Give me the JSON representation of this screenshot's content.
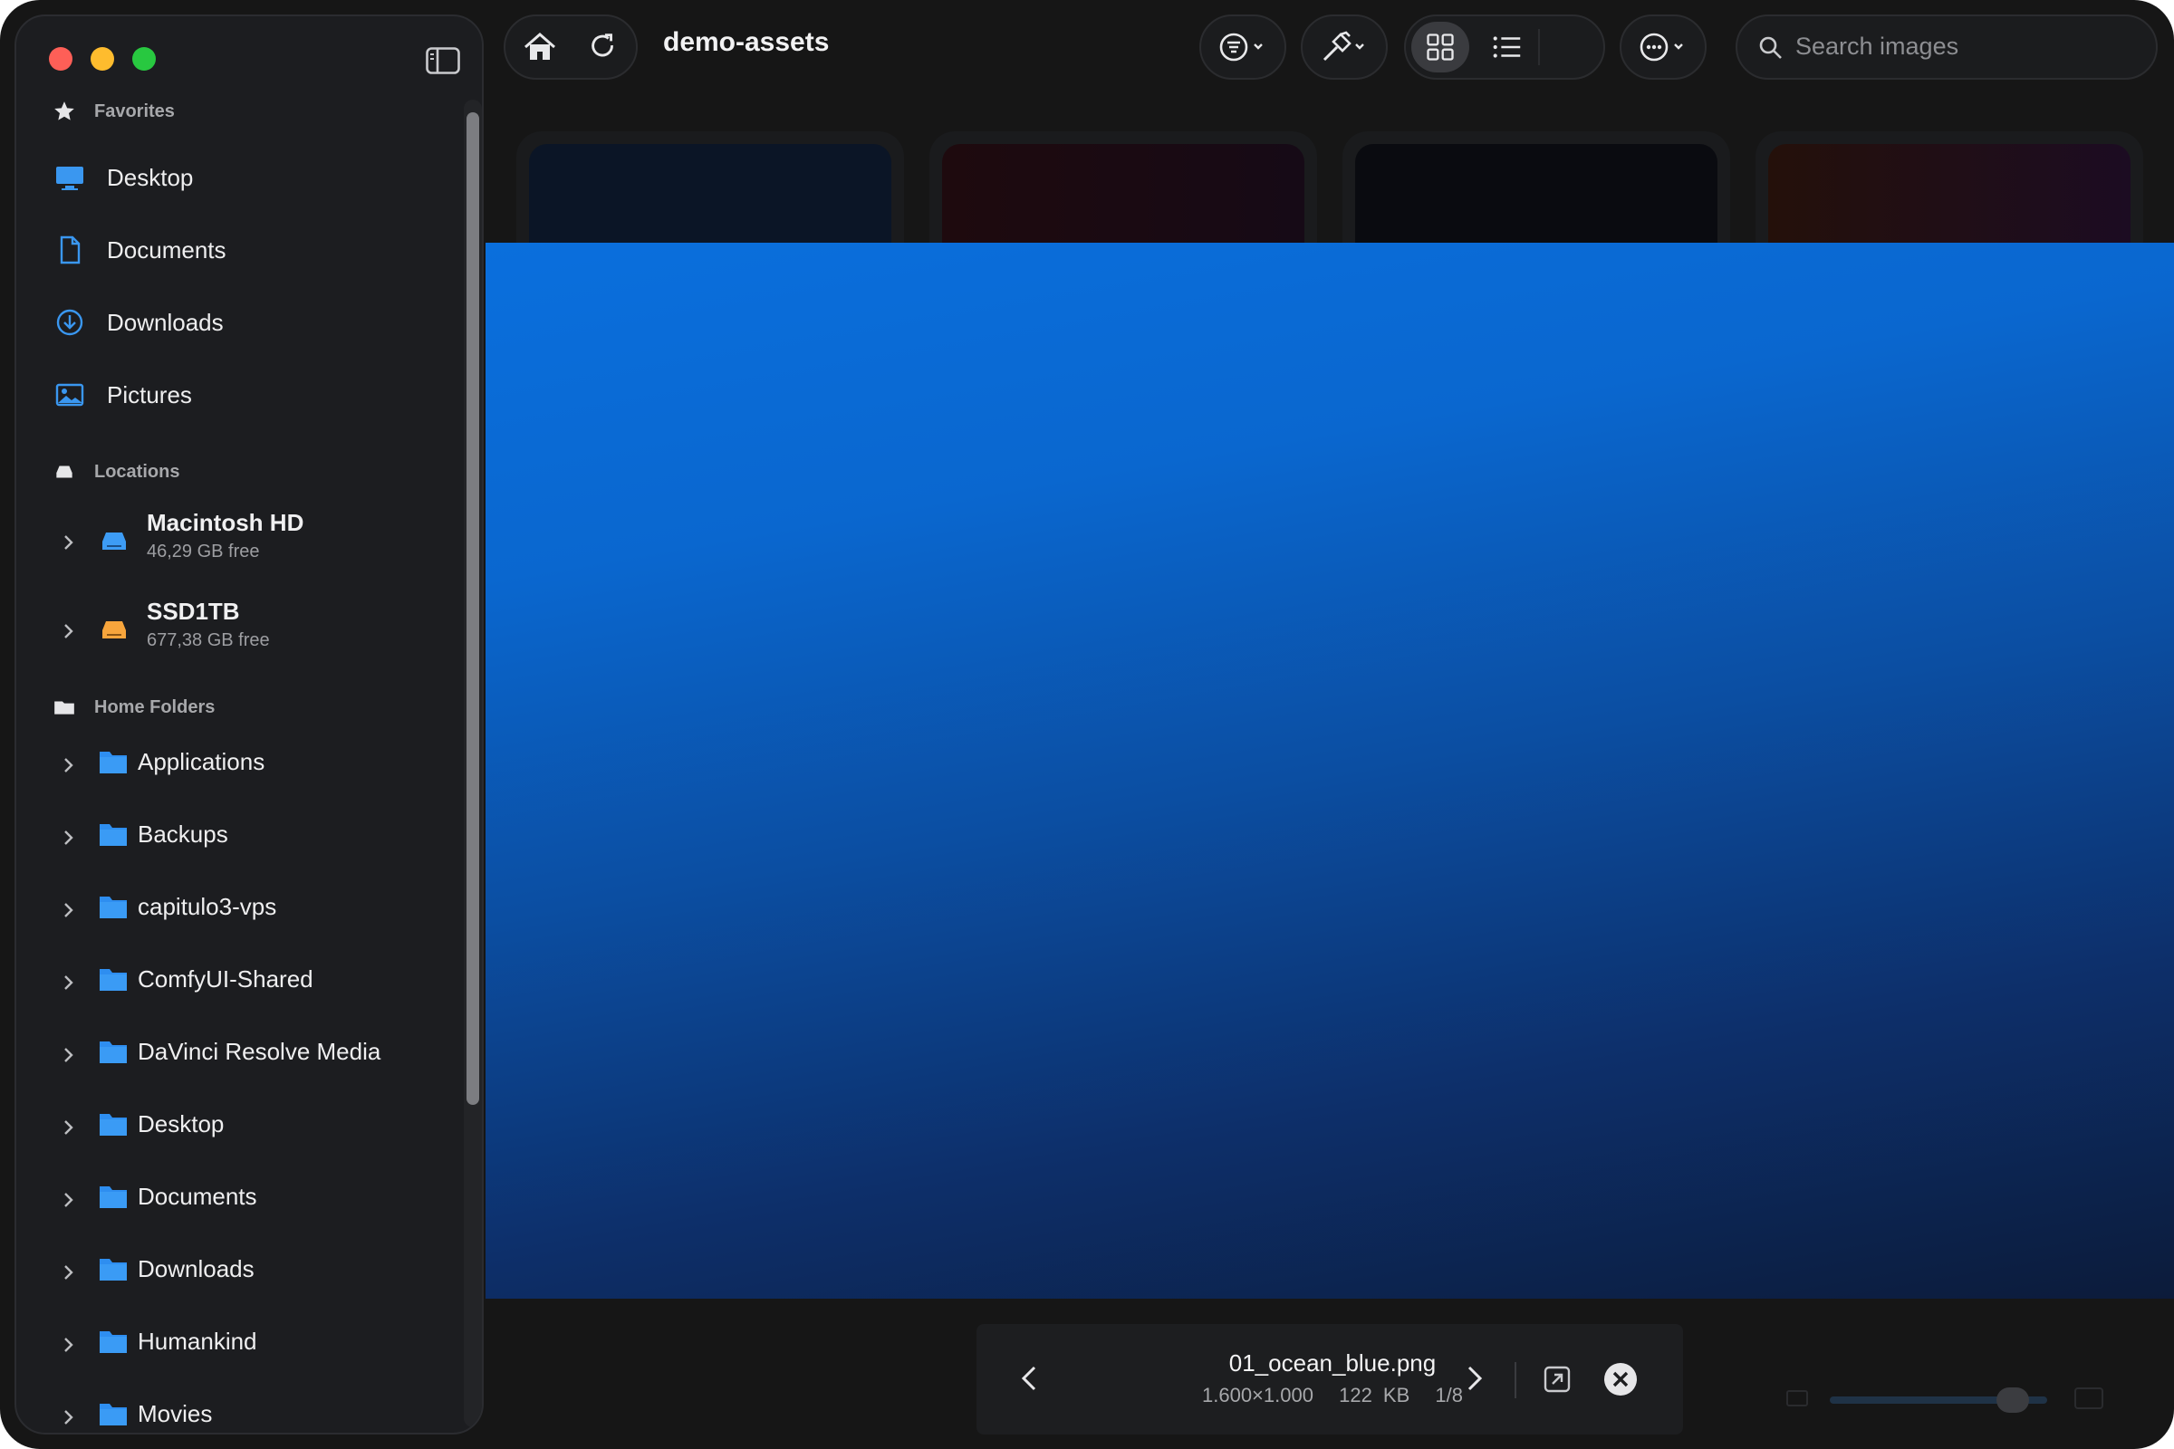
{
  "toolbar": {
    "path_title": "demo-assets",
    "search_placeholder": "Search images"
  },
  "sidebar": {
    "favorites_header": "Favorites",
    "favorites": [
      {
        "label": "Desktop",
        "icon": "desktop-icon"
      },
      {
        "label": "Documents",
        "icon": "document-icon"
      },
      {
        "label": "Downloads",
        "icon": "download-icon"
      },
      {
        "label": "Pictures",
        "icon": "pictures-icon"
      }
    ],
    "locations_header": "Locations",
    "locations": [
      {
        "name": "Macintosh HD",
        "free": "46,29 GB free",
        "color": "#3d9cf5"
      },
      {
        "name": "SSD1TB",
        "free": "677,38 GB free",
        "color": "#f7a53c"
      }
    ],
    "home_header": "Home Folders",
    "home_folders": [
      "Applications",
      "Backups",
      "capitulo3-vps",
      "ComfyUI-Shared",
      "DaVinci Resolve Media",
      "Desktop",
      "Documents",
      "Downloads",
      "Humankind",
      "Movies"
    ]
  },
  "preview": {
    "filename": "01_ocean_blue.png",
    "dimensions": "1.600×1.000",
    "size": "122 KB",
    "index": "1/8"
  },
  "colors": {
    "accent": "#2e8ef0",
    "background": "#161616",
    "sidebar": "#1c1d20"
  }
}
